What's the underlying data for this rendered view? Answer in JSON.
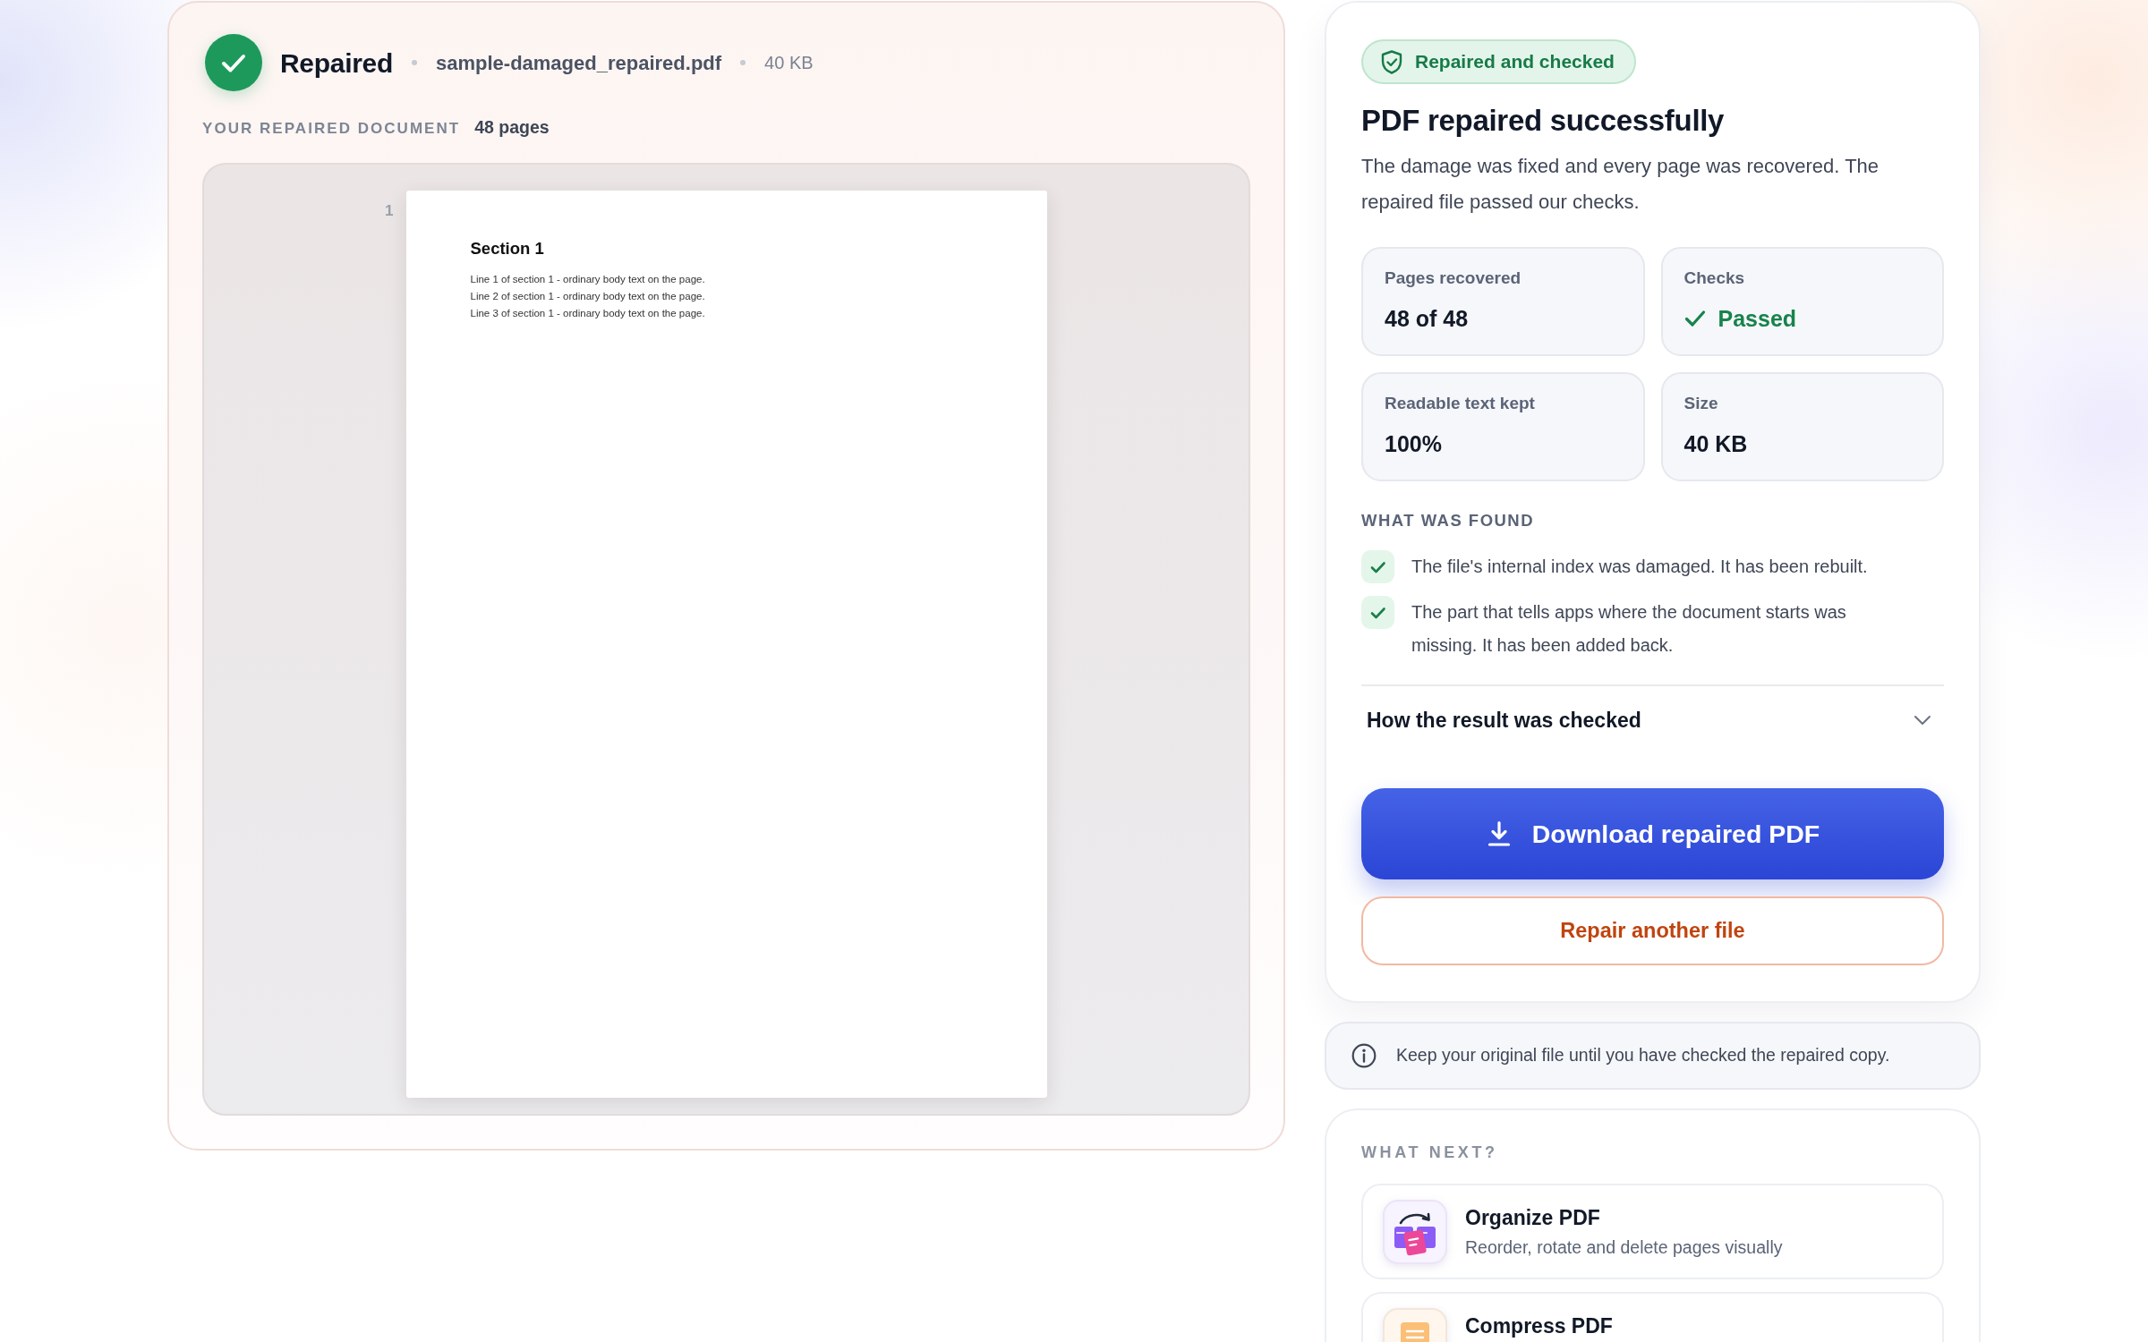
{
  "result": {
    "status": "Repaired",
    "file_name": "sample-damaged_repaired.pdf",
    "file_size": "40 KB",
    "section_label": "YOUR REPAIRED DOCUMENT",
    "page_count": "48 pages",
    "preview": {
      "pages": [
        {
          "number": "1",
          "heading": "Section 1",
          "lines": [
            "Line 1 of section 1 - ordinary body text on the page.",
            "Line 2 of section 1 - ordinary body text on the page.",
            "Line 3 of section 1 - ordinary body text on the page."
          ]
        }
      ]
    }
  },
  "summary": {
    "badge": "Repaired and checked",
    "title": "PDF repaired successfully",
    "description": "The damage was fixed and every page was recovered. The repaired file passed our checks.",
    "stats": [
      {
        "label": "Pages recovered",
        "value": "48 of 48",
        "kind": "plain"
      },
      {
        "label": "Checks",
        "value": "Passed",
        "kind": "check"
      },
      {
        "label": "Readable text kept",
        "value": "100%",
        "kind": "plain"
      },
      {
        "label": "Size",
        "value": "40 KB",
        "kind": "plain"
      }
    ],
    "findings_heading": "WHAT WAS FOUND",
    "findings": [
      "The file's internal index was damaged. It has been rebuilt.",
      "The part that tells apps where the document starts was missing. It has been added back."
    ],
    "details": {
      "label": "How the result was checked",
      "expanded": false
    },
    "download_button": "Download repaired PDF",
    "repair_another_button": "Repair another file"
  },
  "notice": {
    "text": "Keep your original file until you have checked the repaired copy."
  },
  "next_steps": {
    "heading": "WHAT NEXT?",
    "tools": [
      {
        "title": "Organize PDF",
        "description": "Reorder, rotate and delete pages visually",
        "kind": "organize"
      },
      {
        "title": "Compress PDF",
        "kind": "compress"
      }
    ]
  }
}
